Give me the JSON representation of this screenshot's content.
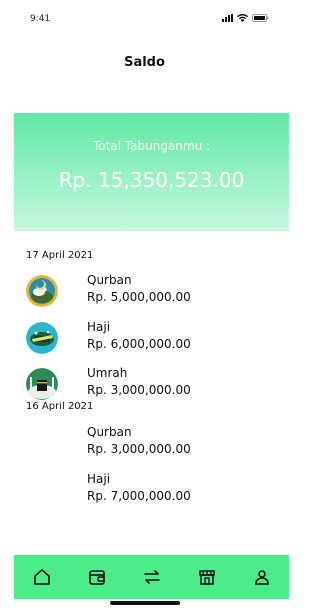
{
  "status_bar": {
    "time": "9:41"
  },
  "header": {
    "title": "Saldo"
  },
  "summary": {
    "label": "Total Tabunganmu :",
    "value": "Rp. 15,350,523.00",
    "colors": {
      "top": "#5fe7a6",
      "bottom": "#c6f7df"
    }
  },
  "groups": [
    {
      "date": "17 April 2021",
      "items": [
        {
          "name": "Qurban",
          "amount": "Rp. 5,000,000.00",
          "icon": "qurban-avatar-icon"
        },
        {
          "name": "Haji",
          "amount": "Rp. 6,000,000.00",
          "icon": "haji-avatar-icon"
        },
        {
          "name": "Umrah",
          "amount": "Rp. 3,000,000.00",
          "icon": "umrah-avatar-icon"
        }
      ]
    },
    {
      "date": "16 April 2021",
      "items": [
        {
          "name": "Qurban",
          "amount": "Rp. 3,000,000.00"
        },
        {
          "name": "Haji",
          "amount": "Rp. 7,000,000.00"
        }
      ]
    }
  ],
  "nav": {
    "background": "#4cec8a",
    "items": [
      "home-icon",
      "wallet-icon",
      "transfer-icon",
      "store-icon",
      "profile-icon"
    ]
  }
}
